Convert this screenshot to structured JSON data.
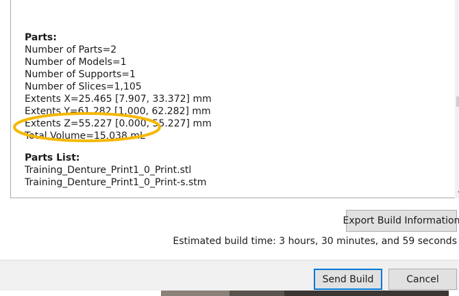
{
  "info": {
    "parts_heading": "Parts:",
    "number_of_parts": "Number of Parts=2",
    "number_of_models": "Number of Models=1",
    "number_of_supports": "Number of Supports=1",
    "number_of_slices": "Number of Slices=1,105",
    "extents_x": "Extents X=25.465 [7.907, 33.372] mm",
    "extents_y": "Extents Y=61.282 [1.000, 62.282] mm",
    "extents_z": "Extents Z=55.227 [0.000, 55.227] mm",
    "total_volume": "Total Volume=15.038 mL",
    "parts_list_heading": "Parts List:",
    "parts_list": [
      "Training_Denture_Print1_0_Print.stl",
      "Training_Denture_Print1_0_Print-s.stm"
    ]
  },
  "buttons": {
    "export_label": "Export Build Information",
    "send_label": "Send Build",
    "cancel_label": "Cancel"
  },
  "estimated_time": "Estimated build time: 3 hours, 30 minutes, and 59 seconds",
  "colors": {
    "highlight": "#f5b800",
    "send_border": "#0078d7"
  },
  "icons": {
    "scroll_down": "chevron-down-icon"
  }
}
